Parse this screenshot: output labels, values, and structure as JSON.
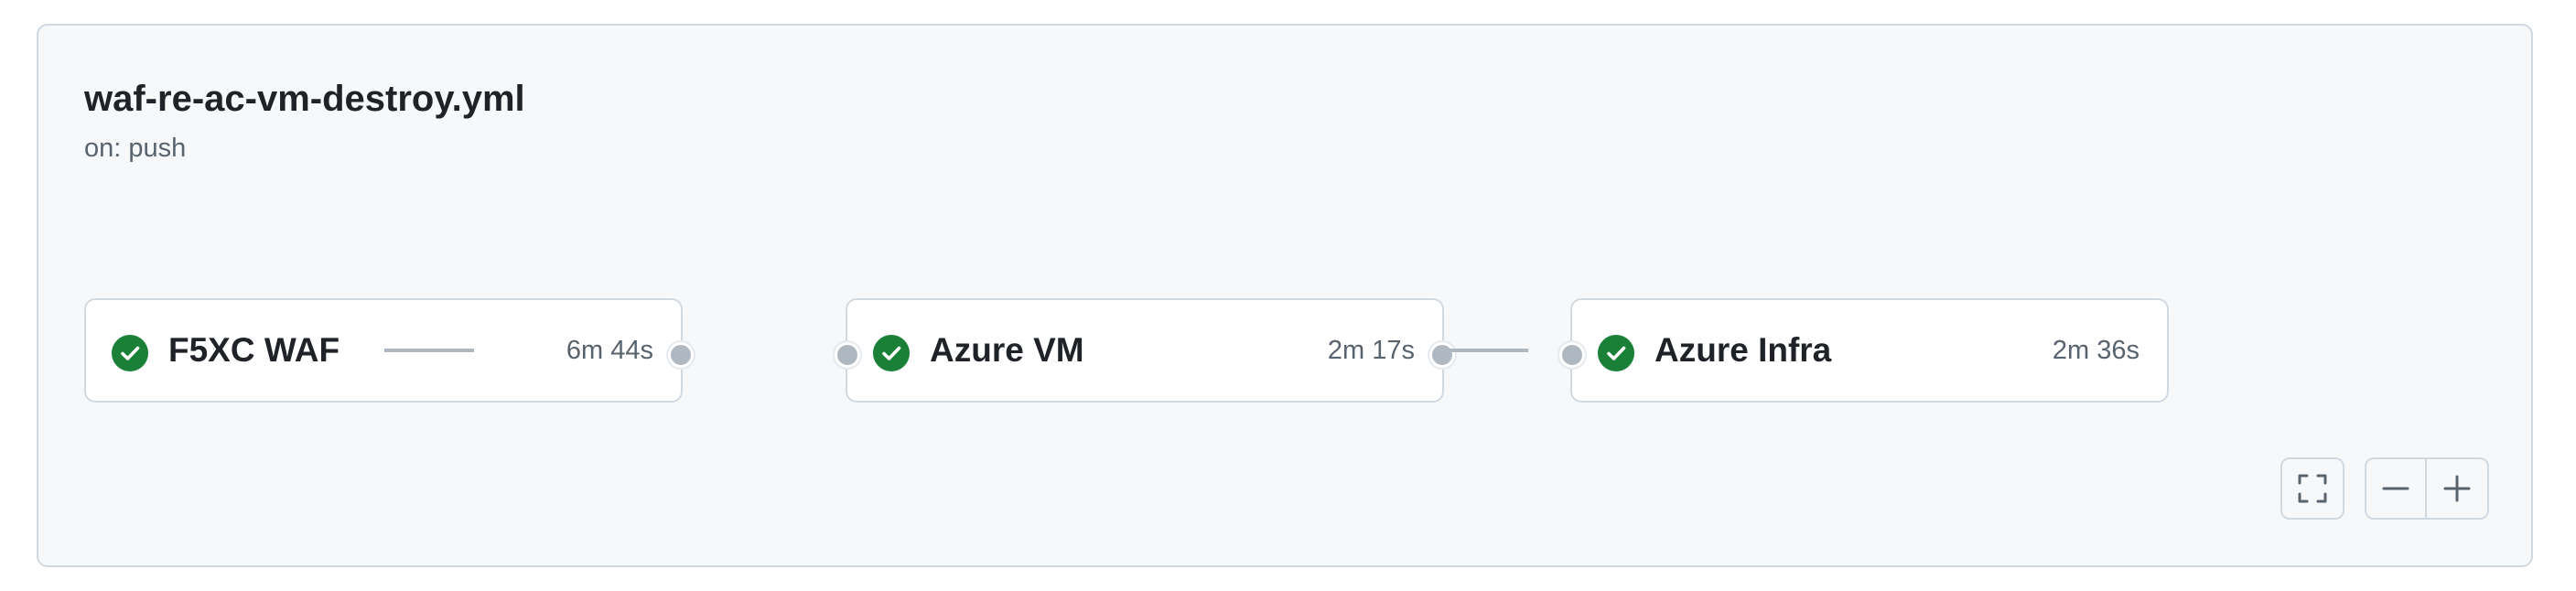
{
  "workflow": {
    "file_name": "waf-re-ac-vm-destroy.yml",
    "trigger": "on: push"
  },
  "jobs": [
    {
      "name": "F5XC WAF",
      "duration": "6m 44s",
      "status": "success",
      "status_icon": "check-circle-icon"
    },
    {
      "name": "Azure VM",
      "duration": "2m 17s",
      "status": "success",
      "status_icon": "check-circle-icon"
    },
    {
      "name": "Azure Infra",
      "duration": "2m 36s",
      "status": "success",
      "status_icon": "check-circle-icon"
    }
  ],
  "controls": {
    "fullscreen_icon": "fullscreen-icon",
    "zoom_out_icon": "minus-icon",
    "zoom_in_icon": "plus-icon"
  },
  "colors": {
    "success": "#1a7f37",
    "panel_bg": "#f6f8fa",
    "border": "#d1d9e0",
    "connector": "#afb8c1"
  }
}
